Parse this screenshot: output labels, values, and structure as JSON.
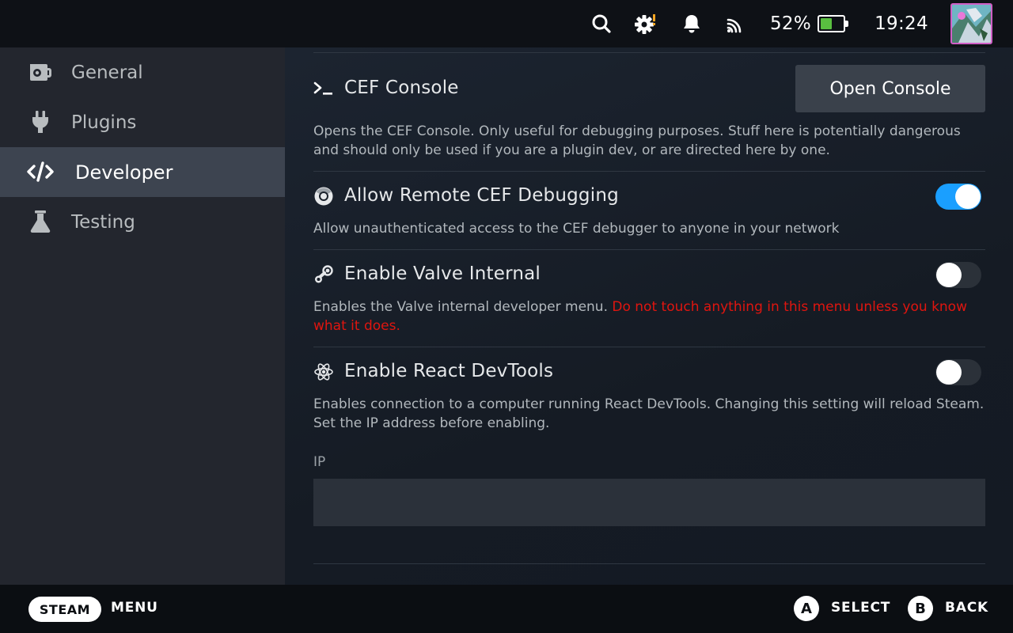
{
  "status_bar": {
    "battery_percent_text": "52%",
    "battery_level": 0.52,
    "time": "19:24",
    "icons": [
      "search-icon",
      "settings-icon",
      "notifications-icon",
      "cast-icon",
      "battery-icon"
    ],
    "colors": {
      "battery_fill": "#59bf40",
      "avatar_border": "#d05fc6"
    }
  },
  "sidebar": {
    "items": [
      {
        "label": "General",
        "icon": "general-icon",
        "active": false
      },
      {
        "label": "Plugins",
        "icon": "plug-icon",
        "active": false
      },
      {
        "label": "Developer",
        "icon": "code-icon",
        "active": true
      },
      {
        "label": "Testing",
        "icon": "flask-icon",
        "active": false
      }
    ]
  },
  "settings": {
    "cef_console": {
      "title": "CEF Console",
      "button_label": "Open Console",
      "description": "Opens the CEF Console. Only useful for debugging purposes. Stuff here is potentially dangerous and should only be used if you are a plugin dev, or are directed here by one."
    },
    "remote_debugging": {
      "title": "Allow Remote CEF Debugging",
      "enabled": true,
      "description": "Allow unauthenticated access to the CEF debugger to anyone in your network"
    },
    "valve_internal": {
      "title": "Enable Valve Internal",
      "enabled": false,
      "description": "Enables the Valve internal developer menu.",
      "warning": "Do not touch anything in this menu unless you know what it does."
    },
    "react_devtools": {
      "title": "Enable React DevTools",
      "enabled": false,
      "description": "Enables connection to a computer running React DevTools. Changing this setting will reload Steam. Set the IP address before enabling.",
      "ip_label": "IP",
      "ip_value": ""
    },
    "colors": {
      "toggle_on": "#1a9fff",
      "warning": "#e0150f"
    }
  },
  "footer": {
    "steam_label": "STEAM",
    "menu_label": "MENU",
    "a_glyph": "A",
    "select_label": "SELECT",
    "b_glyph": "B",
    "back_label": "BACK"
  }
}
